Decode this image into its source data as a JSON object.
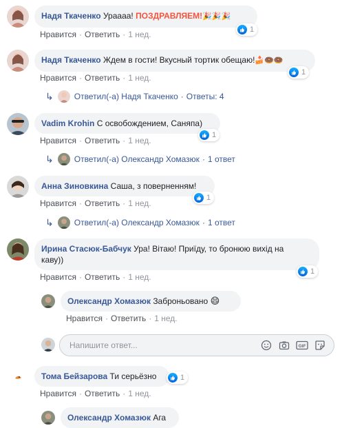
{
  "actions": {
    "like": "Нравится",
    "reply": "Ответить",
    "time": "1 нед."
  },
  "comments": [
    {
      "author": "Надя Ткаченко",
      "text": "Ураааа!",
      "highlight": "ПОЗДРАВЛЯЕМ!",
      "emoji": "🎉🎉🎉",
      "reactions": "1"
    },
    {
      "author": "Надя Ткаченко",
      "text": "Ждем в гости! Вкусный тортик обещаю!",
      "emoji": "🍰🍩🍩",
      "reactions": "1",
      "reply_link": {
        "label": "Ответил(-а) Надя Ткаченко",
        "count": "Ответы: 4"
      }
    },
    {
      "author": "Vadim Krohin",
      "text": "С освобождением, Саняпа)",
      "reactions": "1",
      "reply_link": {
        "label": "Ответил(-а) Олександр Хомазюк",
        "count": "1 ответ"
      }
    },
    {
      "author": "Анна Зиновкина",
      "text": "Саша, з поверненням!",
      "reactions": "1",
      "reply_link": {
        "label": "Ответил(-а) Олександр Хомазюк",
        "count": "1 ответ"
      }
    },
    {
      "author": "Ирина Стасюк-Бабчук",
      "text_line1": "Ура! Вітаю! Приїду, то бронюю вихід на",
      "text_line2": "каву))",
      "reactions": "1",
      "reply": {
        "author": "Олександр Хомазюк",
        "text": "Заброньовано",
        "emoji": "😄"
      }
    },
    {
      "author": "Тома Бейзарова",
      "text": "Ти серьёзно",
      "reactions": "1",
      "reply": {
        "author": "Олександр Хомазюк",
        "text": "Ага"
      }
    }
  ],
  "reply_input": {
    "placeholder": "Напишите ответ..."
  },
  "icons": {
    "like": "like-icon",
    "reply_arrow": "reply-arrow-icon",
    "emoji": "smiley-icon",
    "camera": "camera-icon",
    "gif": "gif-icon",
    "sticker": "sticker-icon"
  },
  "colors": {
    "author": "#385898",
    "highlight": "#f5533d",
    "like": "#1877f2",
    "bubble": "#f2f3f5"
  }
}
